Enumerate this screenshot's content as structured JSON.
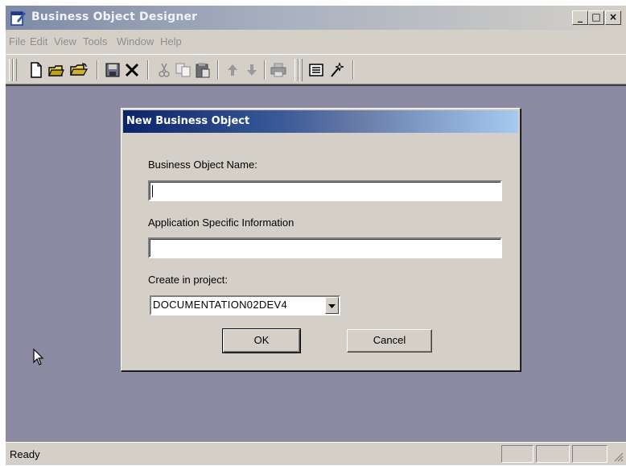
{
  "window": {
    "title": "Business Object Designer",
    "controls": {
      "minimize": "_",
      "maximize": "□",
      "close": "×"
    }
  },
  "menu": [
    "File",
    "Edit",
    "View",
    "Tools",
    "Window",
    "Help"
  ],
  "toolbar": [
    "new-document-icon",
    "open-icon",
    "open-folder-icon",
    "save-icon",
    "delete-icon",
    "cut-icon",
    "copy-icon",
    "paste-icon",
    "move-up-icon",
    "move-down-icon",
    "print-icon",
    "properties-icon",
    "wand-icon"
  ],
  "dialog": {
    "title": "New Business Object",
    "name_label": "Business Object Name:",
    "name_value": "",
    "asi_label": "Application Specific Information",
    "asi_value": "",
    "project_label": "Create in project:",
    "project_value": "DOCUMENTATION02DEV4",
    "ok_label": "OK",
    "cancel_label": "Cancel"
  },
  "status": {
    "text": "Ready"
  }
}
